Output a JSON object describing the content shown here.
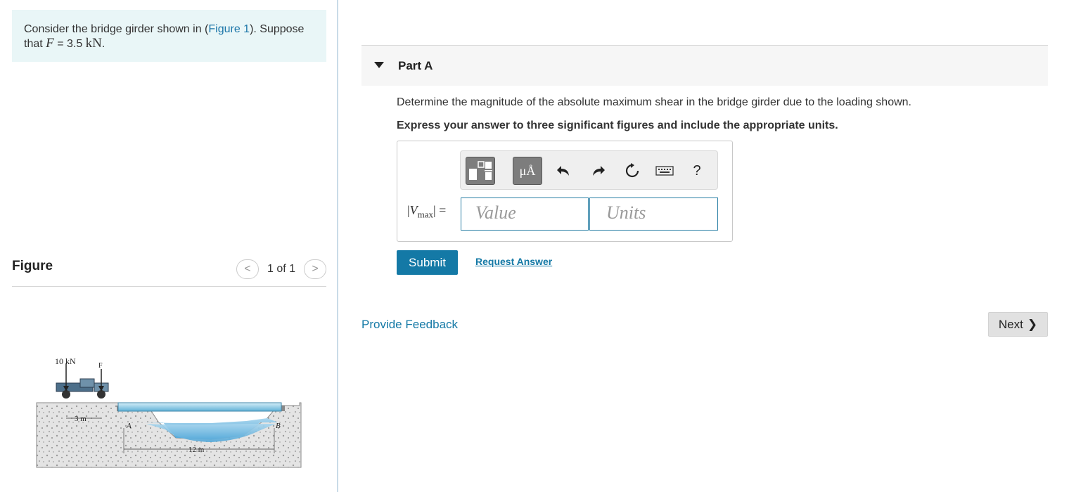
{
  "problem": {
    "text_before": "Consider the bridge girder shown in (",
    "figure_link": "Figure 1",
    "text_after": "). Suppose that ",
    "var": "F",
    "eq": " = 3.5 ",
    "unit": "kN",
    "end": "."
  },
  "figure_panel": {
    "title": "Figure",
    "page_count": "1 of 1",
    "prev_symbol": "<",
    "next_symbol": ">",
    "image": {
      "load_label": "10 kN",
      "force_label": "F",
      "truck_span": "3 m",
      "span_label": "12 m",
      "support_a": "A",
      "support_b": "B"
    }
  },
  "part": {
    "title": "Part A",
    "question": "Determine the magnitude of the absolute maximum shear in the bridge girder due to the loading shown.",
    "instruction": "Express your answer to three significant figures and include the appropriate units."
  },
  "answer": {
    "label_var": "V",
    "label_sub": "max",
    "value_placeholder": "Value",
    "units_placeholder": "Units",
    "toolbar": {
      "units_button": "μÅ",
      "help": "?"
    }
  },
  "actions": {
    "submit": "Submit",
    "request_answer": "Request Answer",
    "feedback": "Provide Feedback",
    "next": "Next",
    "next_symbol": "❯"
  }
}
